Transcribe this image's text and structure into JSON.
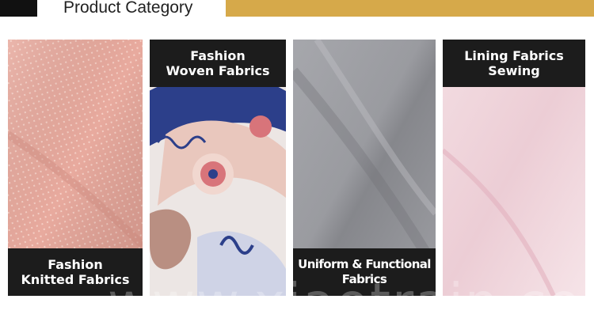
{
  "header": {
    "title": "Product Category"
  },
  "colors": {
    "gold": "#d6a94a",
    "label_bg": "#1c1c1c"
  },
  "categories": [
    {
      "line1": "Fashion",
      "line2": "Knitted Fabrics",
      "swatch": "pink-knit",
      "label_position": "bottom"
    },
    {
      "line1": "Fashion",
      "line2": "Woven Fabrics",
      "swatch": "paisley-print",
      "label_position": "top"
    },
    {
      "line1": "Uniform & Functional",
      "line2": "Fabrics",
      "swatch": "gray-twill",
      "label_position": "bottom"
    },
    {
      "line1": "Lining Fabrics",
      "line2": "Sewing",
      "swatch": "light-pink-lining",
      "label_position": "top"
    }
  ],
  "watermark": "www.xiaotrain.com"
}
